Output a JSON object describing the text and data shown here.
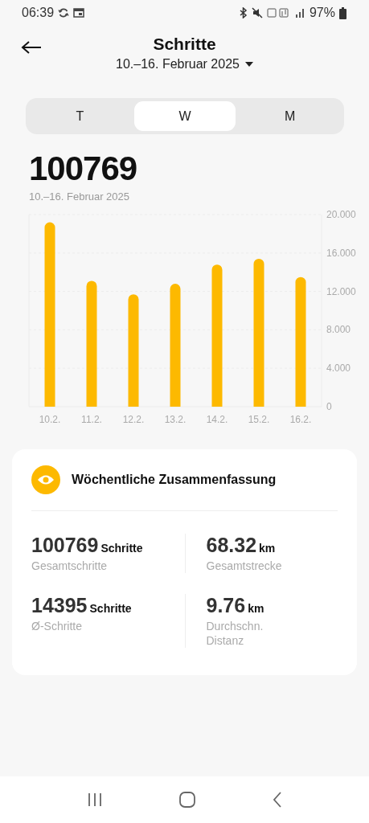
{
  "status_bar": {
    "time": "06:39",
    "battery": "97%"
  },
  "header": {
    "title": "Schritte",
    "period": "10.–16. Februar 2025"
  },
  "tabs": [
    {
      "label": "T",
      "selected": false
    },
    {
      "label": "W",
      "selected": true
    },
    {
      "label": "M",
      "selected": false
    }
  ],
  "total": {
    "value": "100769",
    "period": "10.–16. Februar 2025"
  },
  "chart": {
    "chart_data": {
      "type": "bar",
      "categories": [
        "10.2.",
        "11.2.",
        "12.2.",
        "13.2.",
        "14.2.",
        "15.2.",
        "16.2."
      ],
      "values": [
        19.2,
        13.1,
        11.7,
        12.8,
        14.8,
        15.4,
        13.5
      ],
      "ylim": [
        0,
        20
      ],
      "grid": true,
      "yticks": [
        {
          "value": 0,
          "label": "0"
        },
        {
          "value": 4,
          "label": "4.000"
        },
        {
          "value": 8,
          "label": "8.000"
        },
        {
          "value": 12,
          "label": "12.000"
        },
        {
          "value": 16,
          "label": "16.000"
        },
        {
          "value": 20,
          "label": "20.000"
        }
      ],
      "color": "#fdb900"
    }
  },
  "summary": {
    "title": "Wöchentliche Zusammenfassung",
    "stats": [
      {
        "value": "100769",
        "unit": "Schritte",
        "label": "Gesamtschritte"
      },
      {
        "value": "68.32",
        "unit": "km",
        "label": "Gesamtstrecke"
      },
      {
        "value": "14395",
        "unit": "Schritte",
        "label": "Ø-Schritte"
      },
      {
        "value": "9.76",
        "unit": "km",
        "label": "Durchschn. Distanz"
      }
    ]
  }
}
